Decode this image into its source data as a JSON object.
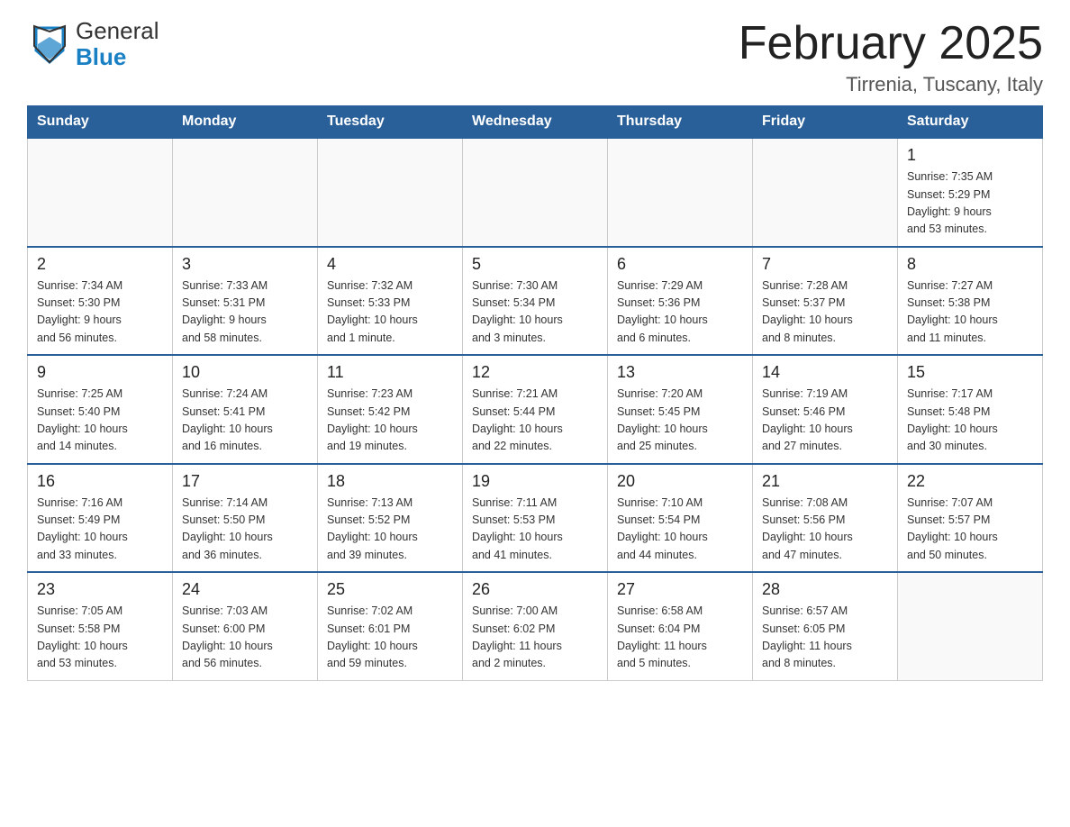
{
  "header": {
    "logo_general": "General",
    "logo_blue": "Blue",
    "month_title": "February 2025",
    "location": "Tirrenia, Tuscany, Italy"
  },
  "calendar": {
    "days_of_week": [
      "Sunday",
      "Monday",
      "Tuesday",
      "Wednesday",
      "Thursday",
      "Friday",
      "Saturday"
    ],
    "weeks": [
      {
        "days": [
          {
            "date": "",
            "info": ""
          },
          {
            "date": "",
            "info": ""
          },
          {
            "date": "",
            "info": ""
          },
          {
            "date": "",
            "info": ""
          },
          {
            "date": "",
            "info": ""
          },
          {
            "date": "",
            "info": ""
          },
          {
            "date": "1",
            "info": "Sunrise: 7:35 AM\nSunset: 5:29 PM\nDaylight: 9 hours\nand 53 minutes."
          }
        ]
      },
      {
        "days": [
          {
            "date": "2",
            "info": "Sunrise: 7:34 AM\nSunset: 5:30 PM\nDaylight: 9 hours\nand 56 minutes."
          },
          {
            "date": "3",
            "info": "Sunrise: 7:33 AM\nSunset: 5:31 PM\nDaylight: 9 hours\nand 58 minutes."
          },
          {
            "date": "4",
            "info": "Sunrise: 7:32 AM\nSunset: 5:33 PM\nDaylight: 10 hours\nand 1 minute."
          },
          {
            "date": "5",
            "info": "Sunrise: 7:30 AM\nSunset: 5:34 PM\nDaylight: 10 hours\nand 3 minutes."
          },
          {
            "date": "6",
            "info": "Sunrise: 7:29 AM\nSunset: 5:36 PM\nDaylight: 10 hours\nand 6 minutes."
          },
          {
            "date": "7",
            "info": "Sunrise: 7:28 AM\nSunset: 5:37 PM\nDaylight: 10 hours\nand 8 minutes."
          },
          {
            "date": "8",
            "info": "Sunrise: 7:27 AM\nSunset: 5:38 PM\nDaylight: 10 hours\nand 11 minutes."
          }
        ]
      },
      {
        "days": [
          {
            "date": "9",
            "info": "Sunrise: 7:25 AM\nSunset: 5:40 PM\nDaylight: 10 hours\nand 14 minutes."
          },
          {
            "date": "10",
            "info": "Sunrise: 7:24 AM\nSunset: 5:41 PM\nDaylight: 10 hours\nand 16 minutes."
          },
          {
            "date": "11",
            "info": "Sunrise: 7:23 AM\nSunset: 5:42 PM\nDaylight: 10 hours\nand 19 minutes."
          },
          {
            "date": "12",
            "info": "Sunrise: 7:21 AM\nSunset: 5:44 PM\nDaylight: 10 hours\nand 22 minutes."
          },
          {
            "date": "13",
            "info": "Sunrise: 7:20 AM\nSunset: 5:45 PM\nDaylight: 10 hours\nand 25 minutes."
          },
          {
            "date": "14",
            "info": "Sunrise: 7:19 AM\nSunset: 5:46 PM\nDaylight: 10 hours\nand 27 minutes."
          },
          {
            "date": "15",
            "info": "Sunrise: 7:17 AM\nSunset: 5:48 PM\nDaylight: 10 hours\nand 30 minutes."
          }
        ]
      },
      {
        "days": [
          {
            "date": "16",
            "info": "Sunrise: 7:16 AM\nSunset: 5:49 PM\nDaylight: 10 hours\nand 33 minutes."
          },
          {
            "date": "17",
            "info": "Sunrise: 7:14 AM\nSunset: 5:50 PM\nDaylight: 10 hours\nand 36 minutes."
          },
          {
            "date": "18",
            "info": "Sunrise: 7:13 AM\nSunset: 5:52 PM\nDaylight: 10 hours\nand 39 minutes."
          },
          {
            "date": "19",
            "info": "Sunrise: 7:11 AM\nSunset: 5:53 PM\nDaylight: 10 hours\nand 41 minutes."
          },
          {
            "date": "20",
            "info": "Sunrise: 7:10 AM\nSunset: 5:54 PM\nDaylight: 10 hours\nand 44 minutes."
          },
          {
            "date": "21",
            "info": "Sunrise: 7:08 AM\nSunset: 5:56 PM\nDaylight: 10 hours\nand 47 minutes."
          },
          {
            "date": "22",
            "info": "Sunrise: 7:07 AM\nSunset: 5:57 PM\nDaylight: 10 hours\nand 50 minutes."
          }
        ]
      },
      {
        "days": [
          {
            "date": "23",
            "info": "Sunrise: 7:05 AM\nSunset: 5:58 PM\nDaylight: 10 hours\nand 53 minutes."
          },
          {
            "date": "24",
            "info": "Sunrise: 7:03 AM\nSunset: 6:00 PM\nDaylight: 10 hours\nand 56 minutes."
          },
          {
            "date": "25",
            "info": "Sunrise: 7:02 AM\nSunset: 6:01 PM\nDaylight: 10 hours\nand 59 minutes."
          },
          {
            "date": "26",
            "info": "Sunrise: 7:00 AM\nSunset: 6:02 PM\nDaylight: 11 hours\nand 2 minutes."
          },
          {
            "date": "27",
            "info": "Sunrise: 6:58 AM\nSunset: 6:04 PM\nDaylight: 11 hours\nand 5 minutes."
          },
          {
            "date": "28",
            "info": "Sunrise: 6:57 AM\nSunset: 6:05 PM\nDaylight: 11 hours\nand 8 minutes."
          },
          {
            "date": "",
            "info": ""
          }
        ]
      }
    ]
  }
}
